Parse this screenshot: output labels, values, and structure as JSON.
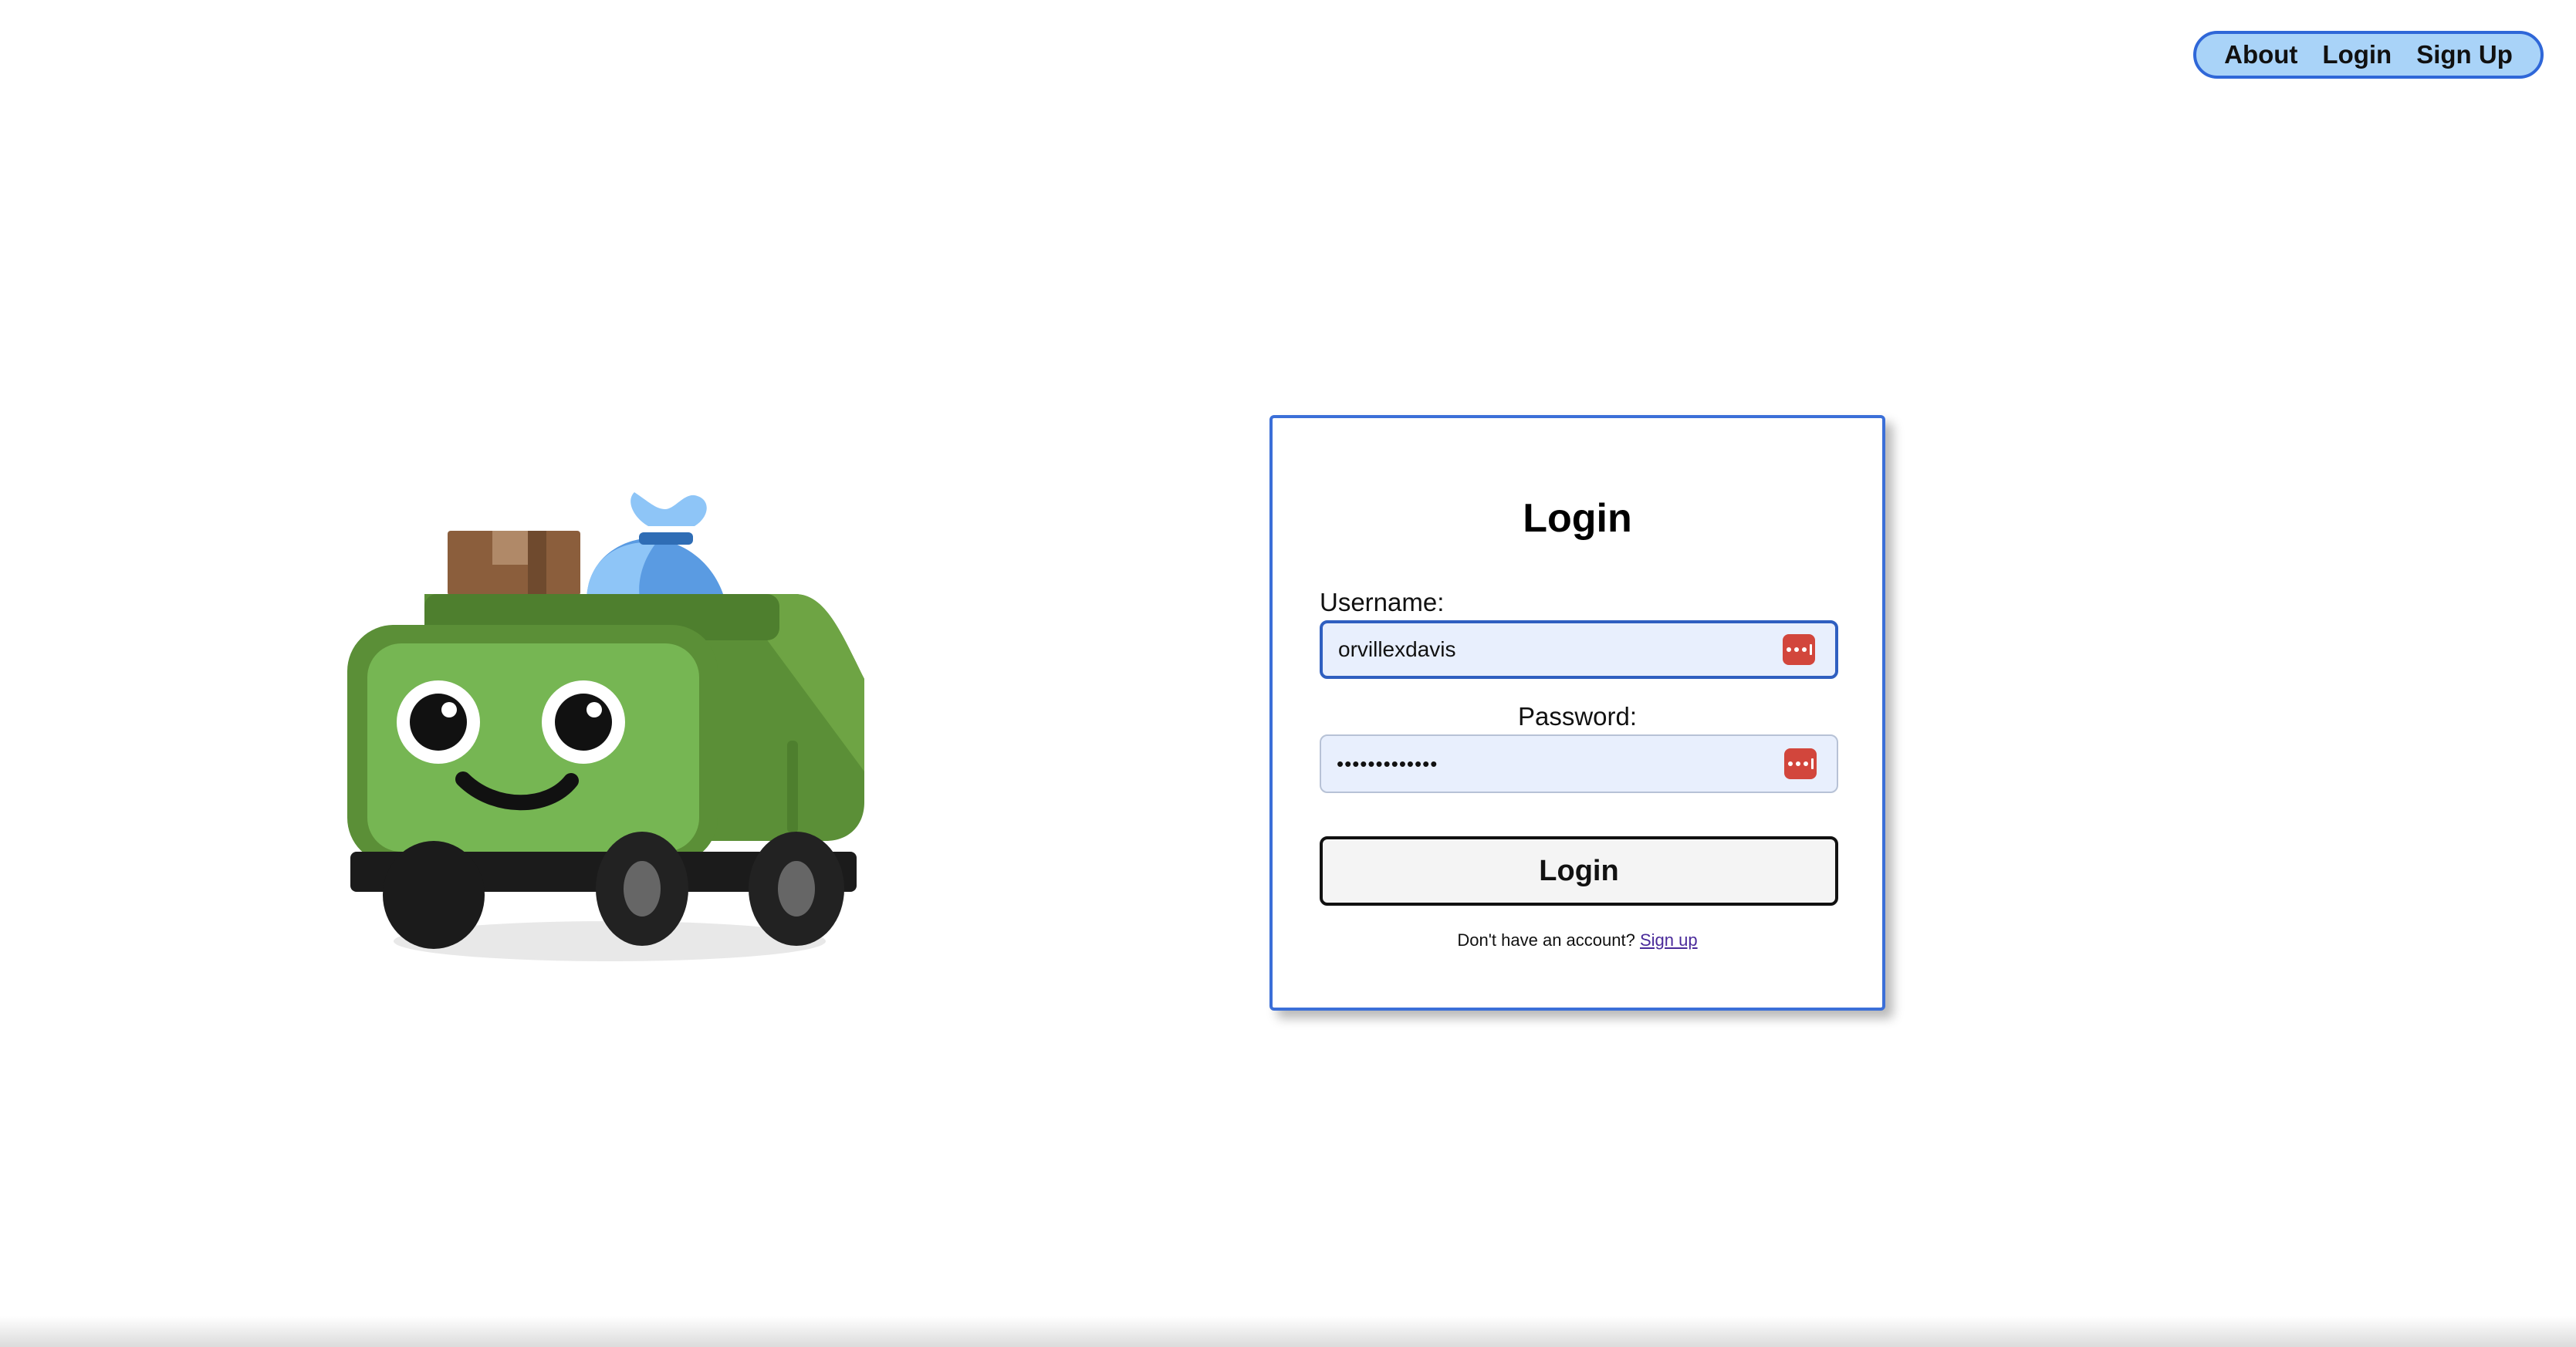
{
  "nav": {
    "items": [
      {
        "label": "About"
      },
      {
        "label": "Login"
      },
      {
        "label": "Sign Up"
      }
    ]
  },
  "login": {
    "title": "Login",
    "username_label": "Username:",
    "username_value": "orvillexdavis",
    "password_label": "Password:",
    "password_value": "•••••••••••••",
    "submit_label": "Login",
    "signup_prompt": "Don't have an account?",
    "signup_link": "Sign up"
  },
  "colors": {
    "nav_fill": "#a9d3f8",
    "nav_border": "#2f67d8",
    "card_border": "#3b6fd8",
    "input_fill": "#e8effd",
    "password_manager_icon": "#d2463c",
    "truck_green": "#76b653",
    "truck_dark_green": "#4e7f2e"
  },
  "icons": {
    "password_manager": "password-manager-icon",
    "illustration": "garbage-truck-mascot"
  }
}
